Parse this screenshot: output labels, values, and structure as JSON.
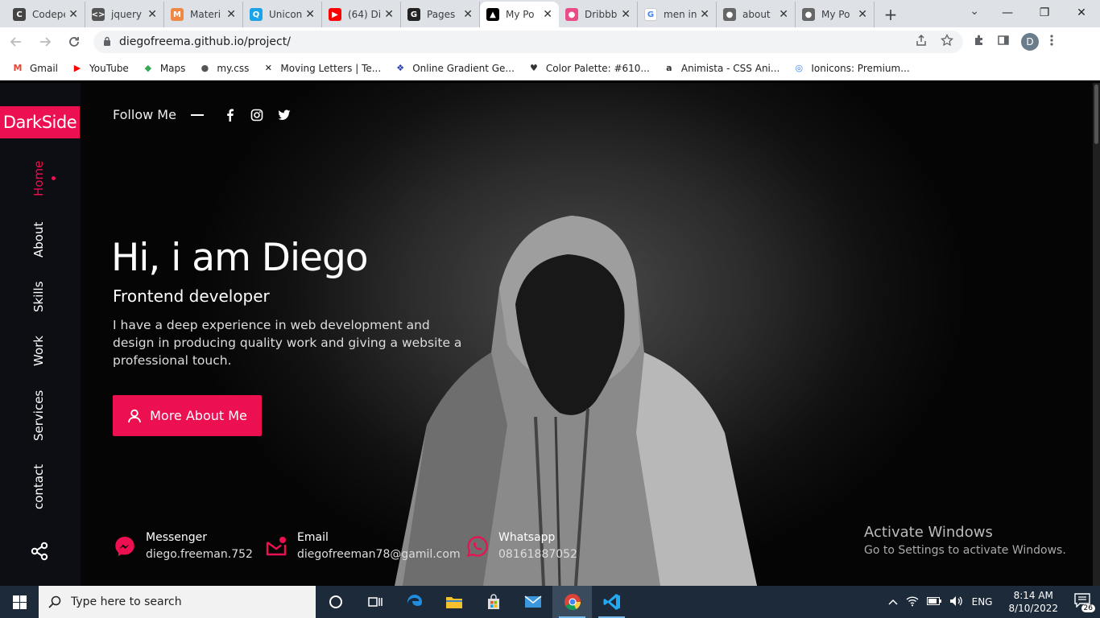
{
  "browser": {
    "tabs": [
      {
        "title": "Codepen",
        "favicon_color": "#444",
        "favicon": "C"
      },
      {
        "title": "jquery",
        "favicon_color": "#555",
        "favicon": "<>"
      },
      {
        "title": "Materi",
        "favicon_color": "#e84",
        "favicon": "M"
      },
      {
        "title": "Unicons",
        "favicon_color": "#1aa3e8",
        "favicon": "Q"
      },
      {
        "title": "(64) Di",
        "favicon_color": "#ff0000",
        "favicon": "▶"
      },
      {
        "title": "Pages",
        "favicon_color": "#222",
        "favicon": "G"
      },
      {
        "title": "My Po",
        "favicon_color": "#000",
        "favicon": "▲",
        "active": true
      },
      {
        "title": "Dribbb",
        "favicon_color": "#ea4c89",
        "favicon": "●"
      },
      {
        "title": "men in",
        "favicon_color": "#fff",
        "favicon": "G"
      },
      {
        "title": "about",
        "favicon_color": "#666",
        "favicon": "●"
      },
      {
        "title": "My Po",
        "favicon_color": "#666",
        "favicon": "●"
      }
    ],
    "url": "diegofreema.github.io/project/",
    "profile_initial": "D",
    "bookmarks": [
      {
        "label": "Gmail",
        "icon": "M",
        "color": "#ea4335"
      },
      {
        "label": "YouTube",
        "icon": "▶",
        "color": "#ff0000"
      },
      {
        "label": "Maps",
        "icon": "◆",
        "color": "#34a853"
      },
      {
        "label": "my.css",
        "icon": "●",
        "color": "#555"
      },
      {
        "label": "Moving Letters | Te...",
        "icon": "✕",
        "color": "#111"
      },
      {
        "label": "Online Gradient Ge...",
        "icon": "❖",
        "color": "#2a3cad"
      },
      {
        "label": "Color Palette: #610...",
        "icon": "♥",
        "color": "#333"
      },
      {
        "label": "Animista - CSS Ani...",
        "icon": "a",
        "color": "#333"
      },
      {
        "label": "Ionicons: Premium...",
        "icon": "◎",
        "color": "#3880ff"
      }
    ]
  },
  "site": {
    "brand": "DarkSide",
    "nav": [
      "Home",
      "About",
      "Skills",
      "Work",
      "Services",
      "contact"
    ],
    "active_nav": "Home",
    "follow_label": "Follow Me",
    "hero_title": "Hi, i am Diego",
    "hero_subtitle": "Frontend developer",
    "hero_description": "I have a deep experience in web development and design in producing quality work and giving a website a professional touch.",
    "cta_label": "More About Me",
    "contacts": [
      {
        "label": "Messenger",
        "value": "diego.freeman.752",
        "icon": "messenger-icon"
      },
      {
        "label": "Email",
        "value": "diegofreeman78@gamil.com",
        "icon": "email-icon"
      },
      {
        "label": "Whatsapp",
        "value": "08161887052",
        "icon": "whatsapp-icon"
      }
    ],
    "accent_color": "#ec1050"
  },
  "watermark": {
    "title": "Activate Windows",
    "subtitle": "Go to Settings to activate Windows."
  },
  "taskbar": {
    "search_placeholder": "Type here to search",
    "language": "ENG",
    "time": "8:14 AM",
    "date": "8/10/2022",
    "notification_count": "26"
  }
}
